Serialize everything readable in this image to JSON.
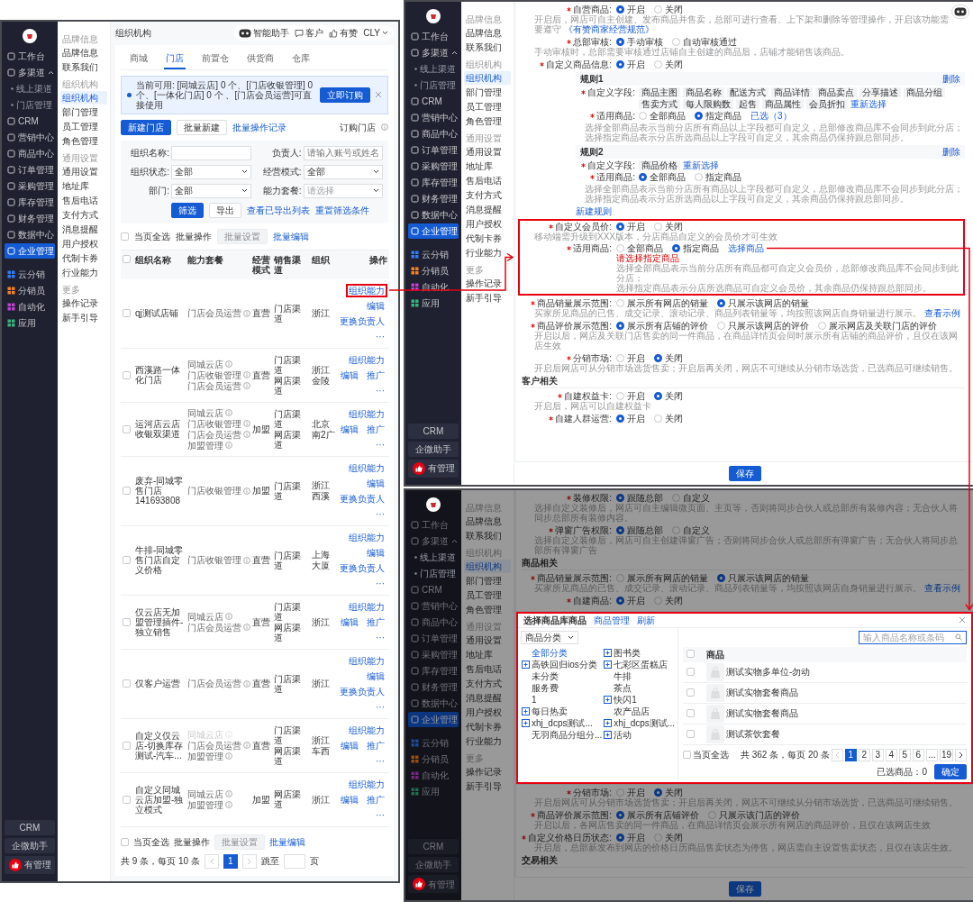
{
  "store_list_screen": {
    "sidebar": {
      "items": [
        {
          "label": "工作台",
          "kind": "item",
          "selected": false
        },
        {
          "label": "多渠道",
          "kind": "group",
          "selected": false
        },
        {
          "label": "线上渠道",
          "kind": "sub",
          "selected": false
        },
        {
          "label": "门店管理",
          "kind": "sub",
          "selected": false
        },
        {
          "label": "CRM",
          "kind": "item",
          "selected": false
        },
        {
          "label": "营销中心",
          "kind": "item",
          "selected": false
        },
        {
          "label": "商品中心",
          "kind": "item",
          "selected": false
        },
        {
          "label": "订单管理",
          "kind": "item",
          "selected": false
        },
        {
          "label": "采购管理",
          "kind": "item",
          "selected": false
        },
        {
          "label": "库存管理",
          "kind": "item",
          "selected": false
        },
        {
          "label": "财务管理",
          "kind": "item",
          "selected": false
        },
        {
          "label": "数据中心",
          "kind": "item",
          "selected": false
        },
        {
          "label": "企业管理",
          "kind": "item",
          "selected": true
        },
        {
          "label": "云分销",
          "kind": "app",
          "selected": false,
          "color": "#2f7cf6"
        },
        {
          "label": "分销员",
          "kind": "app",
          "selected": false,
          "color": "#f5821f"
        },
        {
          "label": "自动化",
          "kind": "app",
          "selected": false,
          "color": "#c040d0"
        },
        {
          "label": "应用",
          "kind": "app",
          "selected": false,
          "color": "#36b37e"
        }
      ],
      "bottom": [
        "CRM",
        "企微助手",
        "有管理"
      ]
    },
    "subnav": [
      {
        "title": "品牌信息",
        "items": [
          {
            "label": "品牌信息",
            "selected": false
          },
          {
            "label": "联系我们",
            "selected": false
          }
        ]
      },
      {
        "title": "组织机构",
        "items": [
          {
            "label": "组织机构",
            "selected": true
          },
          {
            "label": "部门管理",
            "selected": false
          },
          {
            "label": "员工管理",
            "selected": false
          },
          {
            "label": "角色管理",
            "selected": false
          }
        ]
      },
      {
        "title": "通用设置",
        "items": [
          {
            "label": "通用设置",
            "selected": false
          },
          {
            "label": "地址库",
            "selected": false
          },
          {
            "label": "售后电话",
            "selected": false
          },
          {
            "label": "支付方式",
            "selected": false
          },
          {
            "label": "消息提醒",
            "selected": false
          },
          {
            "label": "用户授权",
            "selected": false
          },
          {
            "label": "代制卡券",
            "selected": false
          },
          {
            "label": "行业能力",
            "selected": false
          }
        ]
      },
      {
        "title": "更多",
        "items": [
          {
            "label": "操作记录",
            "selected": false
          },
          {
            "label": "新手引导",
            "selected": false
          }
        ]
      }
    ],
    "breadcrumb": "组织机构",
    "header_actions": [
      {
        "label": "智能助手",
        "kind": "robot"
      },
      {
        "label": "客户",
        "kind": "chat"
      },
      {
        "label": "有赞",
        "kind": "thumb"
      },
      {
        "label": "CLY",
        "kind": "account"
      }
    ],
    "tabs": [
      {
        "label": "商城",
        "selected": false
      },
      {
        "label": "门店",
        "selected": true
      },
      {
        "label": "前置仓",
        "selected": false
      },
      {
        "label": "供货商",
        "selected": false
      },
      {
        "label": "仓库",
        "selected": false
      }
    ],
    "notice": {
      "text": "当前可用: [同城云店] 0 个、[门店收银管理] 0 个、[一体化门店] 0 个 、[门店会员运营]可直接使用",
      "button": "立即订购"
    },
    "actions": {
      "primary": "新建门店",
      "secondary": "批量新建",
      "link": "批量操作记录",
      "right": "订购门店"
    },
    "filters": [
      {
        "label": "组织名称:",
        "kind": "input"
      },
      {
        "label": "负责人:",
        "kind": "input",
        "placeholder": "请输入账号或姓名"
      },
      {
        "label": "组织状态:",
        "kind": "select",
        "value": "全部"
      },
      {
        "label": "经营模式:",
        "kind": "select",
        "value": "全部"
      },
      {
        "label": "部门:",
        "kind": "select",
        "value": "全部"
      },
      {
        "label": "能力套餐:",
        "kind": "select",
        "placeholder": "请选择"
      }
    ],
    "filter_buttons": {
      "primary": "筛选",
      "secondary": "导出",
      "links": [
        "查看已导出列表",
        "重置筛选条件"
      ]
    },
    "bulk_bar": {
      "select_all_checked": false,
      "select_all": "当页全选",
      "label": "批量操作",
      "button": "批量设置",
      "button_disabled": true,
      "link": "批量编辑"
    },
    "table": {
      "header_checked": false,
      "columns": [
        "组织名称",
        "能力套餐",
        "经营模式",
        "销售渠道",
        "组织",
        "操作"
      ],
      "rows": [
        {
          "checked": false,
          "name": "qj测试店铺",
          "packages": [
            {
              "label": "门店会员运营",
              "disabled": false
            }
          ],
          "mode": "直营",
          "channels": [
            "门店渠道"
          ],
          "region": [
            "浙江"
          ],
          "actions": [
            {
              "label": "组织能力",
              "highlighted": true
            },
            {
              "label": "编辑",
              "highlighted": false
            },
            {
              "label": "更换负责人",
              "highlighted": false
            },
            {
              "label": "···",
              "highlighted": false
            }
          ]
        },
        {
          "checked": false,
          "name": "西溪路一体化门店",
          "packages": [
            {
              "label": "同城云店",
              "disabled": false
            },
            {
              "label": "门店收银管理",
              "disabled": false
            },
            {
              "label": "门店会员运营",
              "disabled": false
            }
          ],
          "mode": "直营",
          "channels": [
            "门店渠道",
            "网店渠道"
          ],
          "region": [
            "浙江",
            "金陵"
          ],
          "actions": [
            {
              "label": "组织能力",
              "highlighted": false
            },
            {
              "label": "编辑",
              "highlighted": false
            },
            {
              "label": "推广",
              "highlighted": false
            },
            {
              "label": "···",
              "highlighted": false
            }
          ]
        },
        {
          "checked": false,
          "name": "运河店云店收银双渠道",
          "packages": [
            {
              "label": "同城云店",
              "disabled": false
            },
            {
              "label": "门店收银管理",
              "disabled": false
            },
            {
              "label": "门店会员运营",
              "disabled": false
            },
            {
              "label": "加盟管理",
              "disabled": false
            }
          ],
          "mode": "加盟",
          "channels": [
            "门店渠道",
            "网店渠道"
          ],
          "region": [
            "北京",
            "南2广"
          ],
          "actions": [
            {
              "label": "组织能力",
              "highlighted": false
            },
            {
              "label": "编辑",
              "highlighted": false
            },
            {
              "label": "推广",
              "highlighted": false
            },
            {
              "label": "···",
              "highlighted": false
            }
          ]
        },
        {
          "checked": false,
          "name": "废弃-同城零售门店141693808",
          "packages": [
            {
              "label": "门店收银管理",
              "disabled": false
            }
          ],
          "mode": "加盟",
          "channels": [
            "门店渠道"
          ],
          "region": [
            "浙江",
            "西溪"
          ],
          "actions": [
            {
              "label": "组织能力",
              "highlighted": false
            },
            {
              "label": "编辑",
              "highlighted": false
            },
            {
              "label": "更换负责人",
              "highlighted": false
            },
            {
              "label": "···",
              "highlighted": false
            }
          ]
        },
        {
          "checked": false,
          "name": "牛排-同城零售门店自定义价格",
          "packages": [
            {
              "label": "门店收银管理",
              "disabled": false
            }
          ],
          "mode": "直营",
          "channels": [
            "门店渠道"
          ],
          "region": [
            "上海",
            "大厦"
          ],
          "actions": [
            {
              "label": "组织能力",
              "highlighted": false
            },
            {
              "label": "编辑",
              "highlighted": false
            },
            {
              "label": "更换负责人",
              "highlighted": false
            },
            {
              "label": "···",
              "highlighted": false
            }
          ]
        },
        {
          "checked": false,
          "name": "仅云店无加盟管理插件-独立销售",
          "packages": [
            {
              "label": "同城云店",
              "disabled": false
            },
            {
              "label": "门店会员运营",
              "disabled": false
            }
          ],
          "mode": "直营",
          "channels": [
            "门店渠道",
            "网店渠道"
          ],
          "region": [
            "浙江"
          ],
          "actions": [
            {
              "label": "组织能力",
              "highlighted": false
            },
            {
              "label": "编辑",
              "highlighted": false
            },
            {
              "label": "推广",
              "highlighted": false
            },
            {
              "label": "···",
              "highlighted": false
            }
          ]
        },
        {
          "checked": false,
          "name": "仅客户运营",
          "packages": [
            {
              "label": "门店会员运营",
              "disabled": false
            }
          ],
          "mode": "直营",
          "channels": [
            "门店渠道"
          ],
          "region": [
            "浙江"
          ],
          "actions": [
            {
              "label": "组织能力",
              "highlighted": false
            },
            {
              "label": "编辑",
              "highlighted": false
            },
            {
              "label": "更换负责人",
              "highlighted": false
            },
            {
              "label": "···",
              "highlighted": false
            }
          ]
        },
        {
          "checked": false,
          "name": "自定义仅云店-切换库存测试-汽车...",
          "packages": [
            {
              "label": "同城云店",
              "disabled": true
            },
            {
              "label": "门店会员运营",
              "disabled": false
            },
            {
              "label": "加盟管理",
              "disabled": false
            }
          ],
          "mode": "直营",
          "channels": [
            "门店渠道",
            "网店渠道"
          ],
          "region": [
            "浙江",
            "车西"
          ],
          "actions": [
            {
              "label": "组织能力",
              "highlighted": false
            },
            {
              "label": "编辑",
              "highlighted": false
            },
            {
              "label": "推广",
              "highlighted": false
            },
            {
              "label": "···",
              "highlighted": false
            }
          ]
        },
        {
          "checked": false,
          "name": "自定义同城云店加盟-独立模式",
          "packages": [
            {
              "label": "同城云店",
              "disabled": false
            },
            {
              "label": "加盟管理",
              "disabled": false
            }
          ],
          "mode": "加盟",
          "channels": [
            "网店渠道"
          ],
          "region": [
            "浙江"
          ],
          "actions": [
            {
              "label": "组织能力",
              "highlighted": false
            },
            {
              "label": "编辑",
              "highlighted": false
            },
            {
              "label": "推广",
              "highlighted": false
            },
            {
              "label": "···",
              "highlighted": false
            }
          ]
        }
      ]
    },
    "footer": {
      "select_all_checked": false,
      "select_all": "当页全选",
      "label": "批量操作",
      "button": "批量设置",
      "button_disabled": true,
      "link": "批量编辑",
      "summary": "共 9 条，每页 10 条",
      "pages": [
        {
          "label": "1",
          "selected": true
        }
      ],
      "jump": "跳至",
      "unit": "页"
    }
  },
  "settings_screen": {
    "sidebar": {
      "items": [
        {
          "label": "工作台",
          "kind": "item",
          "selected": false
        },
        {
          "label": "多渠道",
          "kind": "group",
          "selected": false
        },
        {
          "label": "线上渠道",
          "kind": "sub",
          "selected": false
        },
        {
          "label": "门店管理",
          "kind": "sub",
          "selected": false
        },
        {
          "label": "CRM",
          "kind": "item",
          "selected": false
        },
        {
          "label": "营销中心",
          "kind": "item",
          "selected": false
        },
        {
          "label": "商品中心",
          "kind": "item",
          "selected": false
        },
        {
          "label": "订单管理",
          "kind": "item",
          "selected": false
        },
        {
          "label": "采购管理",
          "kind": "item",
          "selected": false
        },
        {
          "label": "库存管理",
          "kind": "item",
          "selected": false
        },
        {
          "label": "财务管理",
          "kind": "item",
          "selected": false
        },
        {
          "label": "数据中心",
          "kind": "item",
          "selected": false
        },
        {
          "label": "企业管理",
          "kind": "item",
          "selected": true
        },
        {
          "label": "云分销",
          "kind": "app",
          "selected": false,
          "color": "#2f7cf6"
        },
        {
          "label": "分销员",
          "kind": "app",
          "selected": false,
          "color": "#f5821f"
        },
        {
          "label": "自动化",
          "kind": "app",
          "selected": false,
          "color": "#c040d0"
        },
        {
          "label": "应用",
          "kind": "app",
          "selected": false,
          "color": "#36b37e"
        }
      ],
      "bottom": [
        "CRM",
        "企微助手",
        "有管理"
      ]
    },
    "subnav": [
      {
        "title": "品牌信息",
        "items": [
          {
            "label": "品牌信息",
            "selected": false
          },
          {
            "label": "联系我们",
            "selected": false
          }
        ]
      },
      {
        "title": "组织机构",
        "items": [
          {
            "label": "组织机构",
            "selected": true
          },
          {
            "label": "部门管理",
            "selected": false
          },
          {
            "label": "员工管理",
            "selected": false
          },
          {
            "label": "角色管理",
            "selected": false
          }
        ]
      },
      {
        "title": "通用设置",
        "items": [
          {
            "label": "通用设置",
            "selected": false
          },
          {
            "label": "地址库",
            "selected": false
          },
          {
            "label": "售后电话",
            "selected": false
          },
          {
            "label": "支付方式",
            "selected": false
          },
          {
            "label": "消息提醒",
            "selected": false
          },
          {
            "label": "用户授权",
            "selected": false
          },
          {
            "label": "代制卡券",
            "selected": false
          },
          {
            "label": "行业能力",
            "selected": false
          }
        ]
      },
      {
        "title": "更多",
        "items": [
          {
            "label": "操作记录",
            "selected": false
          },
          {
            "label": "新手引导",
            "selected": false
          }
        ]
      }
    ],
    "form": [
      {
        "kind": "radio",
        "label": "自营商品:",
        "options": [
          {
            "label": "开启",
            "selected": true
          },
          {
            "label": "关闭",
            "selected": false
          }
        ],
        "desc": [
          "开启后，网店可自主创建、发布商品并售卖，总部可进行查看、上下架和删除等管理操作，开启该功能需要遵守"
        ],
        "link": "《有赞商家经营规范》"
      },
      {
        "kind": "radio",
        "label": "总部审核:",
        "options": [
          {
            "label": "手动审核",
            "selected": true
          },
          {
            "label": "自动审核通过",
            "selected": false
          }
        ],
        "desc": [
          "手动审核时，总部需要审核通过店铺自主创建的商品后，店铺才能销售该商品。"
        ]
      },
      {
        "kind": "radio",
        "label": "自定义商品信息:",
        "options": [
          {
            "label": "开启",
            "selected": true
          },
          {
            "label": "关闭",
            "selected": false
          }
        ]
      },
      {
        "kind": "rule",
        "title": "规则1",
        "delete": "删除",
        "fields_label": "自定义字段:",
        "tags": [
          "商品主图",
          "商品名称",
          "配送方式",
          "商品详情",
          "商品卖点",
          "分享描述",
          "商品分组",
          "售卖方式",
          "每人限购数",
          "起售",
          "商品属性",
          "会员折扣"
        ],
        "reselect": "重新选择",
        "scope_label": "适用商品:",
        "options": [
          {
            "label": "全部商品",
            "selected": false
          },
          {
            "label": "指定商品",
            "selected": true
          }
        ],
        "scope_link": "已选（3）",
        "desc": [
          "选择全部商品表示当前分店所有商品以上字段都可自定义，总部修改商品库不会同步到此分店；",
          "选择指定商品表示分店所选商品以上字段可自定义，其余商品仍保持跟总部同步。"
        ]
      },
      {
        "kind": "rule",
        "title": "规则2",
        "delete": "删除",
        "fields_label": "自定义字段:",
        "tags": [
          "商品价格"
        ],
        "reselect": "重新选择",
        "scope_label": "适用商品:",
        "options": [
          {
            "label": "全部商品",
            "selected": true
          },
          {
            "label": "指定商品",
            "selected": false
          }
        ],
        "desc": [
          "选择全部商品表示当前分店所有商品以上字段都可自定义，总部修改商品库不会同步到此分店；",
          "选择指定商品表示分店所选商品以上字段可自定义，其余商品仍保持跟总部同步。"
        ]
      },
      {
        "kind": "link",
        "label": "新建规则"
      },
      {
        "kind": "radio",
        "label": "自定义会员价:",
        "highlighted": true,
        "options": [
          {
            "label": "开启",
            "selected": true
          },
          {
            "label": "关闭",
            "selected": false
          }
        ],
        "desc": [
          "移动端需升级到XXX版本，分店商品自定义的会员价才可生效"
        ],
        "sub": {
          "label": "适用商品:",
          "options": [
            {
              "label": "全部商品",
              "selected": false
            },
            {
              "label": "指定商品",
              "selected": true
            }
          ],
          "link": "选择商品",
          "error": "请选择指定商品",
          "desc": [
            "选择全部商品表示当前分店所有商品都可自定义会员价，总部修改商品库不会同步到此分店；",
            "选择指定商品表示分店所选商品可自定义会员价，其余商品仍保持跟总部同步。"
          ]
        }
      },
      {
        "kind": "radio",
        "label": "商品销量展示范围:",
        "options": [
          {
            "label": "展示所有网店的销量",
            "selected": false
          },
          {
            "label": "只展示该网店的销量",
            "selected": true
          }
        ],
        "desc": [
          "买家所见商品的已售、成交记录、滚动记录、商品列表销量等，均按照该网店自身销量进行展示。"
        ],
        "link": "查看示例"
      },
      {
        "kind": "radio",
        "label": "商品评价展示范围:",
        "options": [
          {
            "label": "展示所有店铺的评价",
            "selected": true
          },
          {
            "label": "只展示该网店的评价",
            "selected": false
          },
          {
            "label": "展示网店及关联门店的评价",
            "selected": false
          }
        ],
        "desc": [
          "开启以后，网店及关联门店售卖的同一件商品，在商品详情页会同时展示所有店铺的商品评价，且仅在该网店生效"
        ]
      },
      {
        "kind": "radio",
        "label": "分销市场:",
        "options": [
          {
            "label": "开启",
            "selected": false
          },
          {
            "label": "关闭",
            "selected": true
          }
        ],
        "desc": [
          "开启后网店可从分销市场选货售卖；开启后再关闭，网店不可继续从分销市场选货，已选商品可继续销售。"
        ]
      },
      {
        "kind": "section",
        "label": "客户相关"
      },
      {
        "kind": "radio",
        "label": "自建权益卡:",
        "options": [
          {
            "label": "开启",
            "selected": false
          },
          {
            "label": "关闭",
            "selected": true
          }
        ],
        "desc": [
          "开启后，网店可以自建权益卡"
        ]
      },
      {
        "kind": "radio",
        "label": "自建人群运营:",
        "options": [
          {
            "label": "开启",
            "selected": true
          },
          {
            "label": "关闭",
            "selected": false
          }
        ]
      }
    ],
    "save": "保存"
  },
  "picker_screen": {
    "sidebar": {
      "items": [
        {
          "label": "工作台",
          "kind": "item",
          "selected": false
        },
        {
          "label": "多渠道",
          "kind": "group",
          "selected": false
        },
        {
          "label": "线上渠道",
          "kind": "sub",
          "selected": false
        },
        {
          "label": "门店管理",
          "kind": "sub",
          "selected": false
        },
        {
          "label": "CRM",
          "kind": "item",
          "selected": false
        },
        {
          "label": "营销中心",
          "kind": "item",
          "selected": false
        },
        {
          "label": "商品中心",
          "kind": "item",
          "selected": false
        },
        {
          "label": "订单管理",
          "kind": "item",
          "selected": false
        },
        {
          "label": "采购管理",
          "kind": "item",
          "selected": false
        },
        {
          "label": "库存管理",
          "kind": "item",
          "selected": false
        },
        {
          "label": "财务管理",
          "kind": "item",
          "selected": false
        },
        {
          "label": "数据中心",
          "kind": "item",
          "selected": false
        },
        {
          "label": "企业管理",
          "kind": "item",
          "selected": true
        },
        {
          "label": "云分销",
          "kind": "app",
          "selected": false,
          "color": "#1c4a94"
        },
        {
          "label": "分销员",
          "kind": "app",
          "selected": false,
          "color": "#934e13"
        },
        {
          "label": "自动化",
          "kind": "app",
          "selected": false,
          "color": "#73267d"
        },
        {
          "label": "应用",
          "kind": "app",
          "selected": false,
          "color": "#206b4c"
        }
      ],
      "bottom": [
        "CRM",
        "企微助手",
        "有管理"
      ]
    },
    "subnav": [
      {
        "title": "品牌信息",
        "items": [
          {
            "label": "品牌信息",
            "selected": false
          },
          {
            "label": "联系我们",
            "selected": false
          }
        ]
      },
      {
        "title": "组织机构",
        "items": [
          {
            "label": "组织机构",
            "selected": true
          },
          {
            "label": "部门管理",
            "selected": false
          },
          {
            "label": "员工管理",
            "selected": false
          },
          {
            "label": "角色管理",
            "selected": false
          }
        ]
      },
      {
        "title": "通用设置",
        "items": [
          {
            "label": "通用设置",
            "selected": false
          },
          {
            "label": "地址库",
            "selected": false
          },
          {
            "label": "售后电话",
            "selected": false
          },
          {
            "label": "支付方式",
            "selected": false
          },
          {
            "label": "消息提醒",
            "selected": false
          },
          {
            "label": "用户授权",
            "selected": false
          },
          {
            "label": "代制卡券",
            "selected": false
          },
          {
            "label": "行业能力",
            "selected": false
          }
        ]
      },
      {
        "title": "更多",
        "items": [
          {
            "label": "操作记录",
            "selected": false
          },
          {
            "label": "新手引导",
            "selected": false
          }
        ]
      }
    ],
    "form_above_dialog": [
      {
        "kind": "radio",
        "label": "装修权限:",
        "options": [
          {
            "label": "跟随总部",
            "selected": true
          },
          {
            "label": "自定义",
            "selected": false
          }
        ],
        "desc": [
          "选择自定义装修后，网店可自主编辑微页面、主页等，否则将同步合伙人或总部所有装修内容；无合伙人将同步总部所有装修内容。"
        ]
      },
      {
        "kind": "radio",
        "label": "弹窗广告权限:",
        "options": [
          {
            "label": "跟随总部",
            "selected": true
          },
          {
            "label": "自定义",
            "selected": false
          }
        ],
        "desc": [
          "选择自定义装修后，网店可自主创建弹窗广告；否则将同步合伙人或总部所有弹窗广告；无合伙人将同步总部所有弹窗广告"
        ]
      },
      {
        "kind": "section",
        "label": "商品相关"
      },
      {
        "kind": "radio",
        "label": "商品销量展示范围:",
        "options": [
          {
            "label": "展示所有网店的销量",
            "selected": false
          },
          {
            "label": "只展示该网店的销量",
            "selected": true
          }
        ],
        "desc": [
          "买家所见商品的已售、成交记录、滚动记录、商品列表销量等，均按照该网店自身销量进行展示。"
        ],
        "link": "查看示例"
      },
      {
        "kind": "radio",
        "label": "自建商品:",
        "options": [
          {
            "label": "开启",
            "selected": true
          },
          {
            "label": "关闭",
            "selected": false
          }
        ]
      }
    ],
    "dialog": {
      "title": "选择商品库商品",
      "links": [
        "商品管理",
        "刷新"
      ],
      "category_select": "商品分类",
      "search_placeholder": "输入商品名称或条码",
      "tree": [
        {
          "label": "全部分类",
          "selected": true,
          "expandable": false
        },
        {
          "label": "图书类",
          "selected": false,
          "expandable": true
        },
        {
          "label": "高铁回归ios分类",
          "selected": false,
          "expandable": true
        },
        {
          "label": "七彩区蛋糕店",
          "selected": false,
          "expandable": true
        },
        {
          "label": "未分类",
          "selected": false,
          "expandable": false
        },
        {
          "label": "牛排",
          "selected": false,
          "expandable": false
        },
        {
          "label": "服务费",
          "selected": false,
          "expandable": false
        },
        {
          "label": "茶点",
          "selected": false,
          "expandable": false
        },
        {
          "label": "1",
          "selected": false,
          "expandable": false
        },
        {
          "label": "快闪1",
          "selected": false,
          "expandable": true
        },
        {
          "label": "每日热卖",
          "selected": false,
          "expandable": true
        },
        {
          "label": "农产品店",
          "selected": false,
          "expandable": false
        },
        {
          "label": "xhj_dcps测试...",
          "selected": false,
          "expandable": true
        },
        {
          "label": "xhj_dcps测试...",
          "selected": false,
          "expandable": true
        },
        {
          "label": "无羽商品分组分...",
          "selected": false,
          "expandable": false
        },
        {
          "label": "活动",
          "selected": false,
          "expandable": true
        }
      ],
      "header_checked": false,
      "column": "商品",
      "products": [
        {
          "name": "测试实物多单位-勿动",
          "checked": false
        },
        {
          "name": "测试实物套餐商品",
          "checked": false
        },
        {
          "name": "测试实物套餐商品",
          "checked": false
        },
        {
          "name": "测试茶饮套餐",
          "checked": false
        }
      ],
      "select_all_checked": false,
      "select_all": "当页全选",
      "summary": "共 362 条，每页 20 条",
      "pages": [
        {
          "label": "1",
          "selected": true
        },
        {
          "label": "2",
          "selected": false
        },
        {
          "label": "3",
          "selected": false
        },
        {
          "label": "4",
          "selected": false
        },
        {
          "label": "5",
          "selected": false
        },
        {
          "label": "6",
          "selected": false
        },
        {
          "label": "...",
          "selected": false
        },
        {
          "label": "19",
          "selected": false
        }
      ],
      "selected_count": "已选商品：0",
      "confirm": "确定"
    },
    "form_below_dialog": [
      {
        "kind": "radio",
        "label": "分销市场:",
        "options": [
          {
            "label": "开启",
            "selected": false
          },
          {
            "label": "关闭",
            "selected": true
          }
        ],
        "desc": [
          "开启后网店可从分销市场选货售卖；开启后再关闭，网店不可继续从分销市场选货，已选商品可继续销售。"
        ]
      },
      {
        "kind": "radio",
        "label": "商品评价展示范围:",
        "options": [
          {
            "label": "展示所有店铺评价",
            "selected": true
          },
          {
            "label": "只展示该门店的评价",
            "selected": false
          }
        ],
        "desc": [
          "开启以后，各网店售卖的同一件商品，在商品详情页会展示所有网店的商品评价，且仅在该网店生效"
        ]
      },
      {
        "kind": "radio",
        "label": "自定义价格日历状态:",
        "options": [
          {
            "label": "开启",
            "selected": true
          },
          {
            "label": "关闭",
            "selected": false
          }
        ],
        "desc": [
          "开启后，总部新发布到网店的价格日历商品售卖状态为停售，网店需自主设置售卖状态，且仅在该店生效。"
        ]
      },
      {
        "kind": "section",
        "label": "交易相关"
      }
    ],
    "save": "保存"
  }
}
